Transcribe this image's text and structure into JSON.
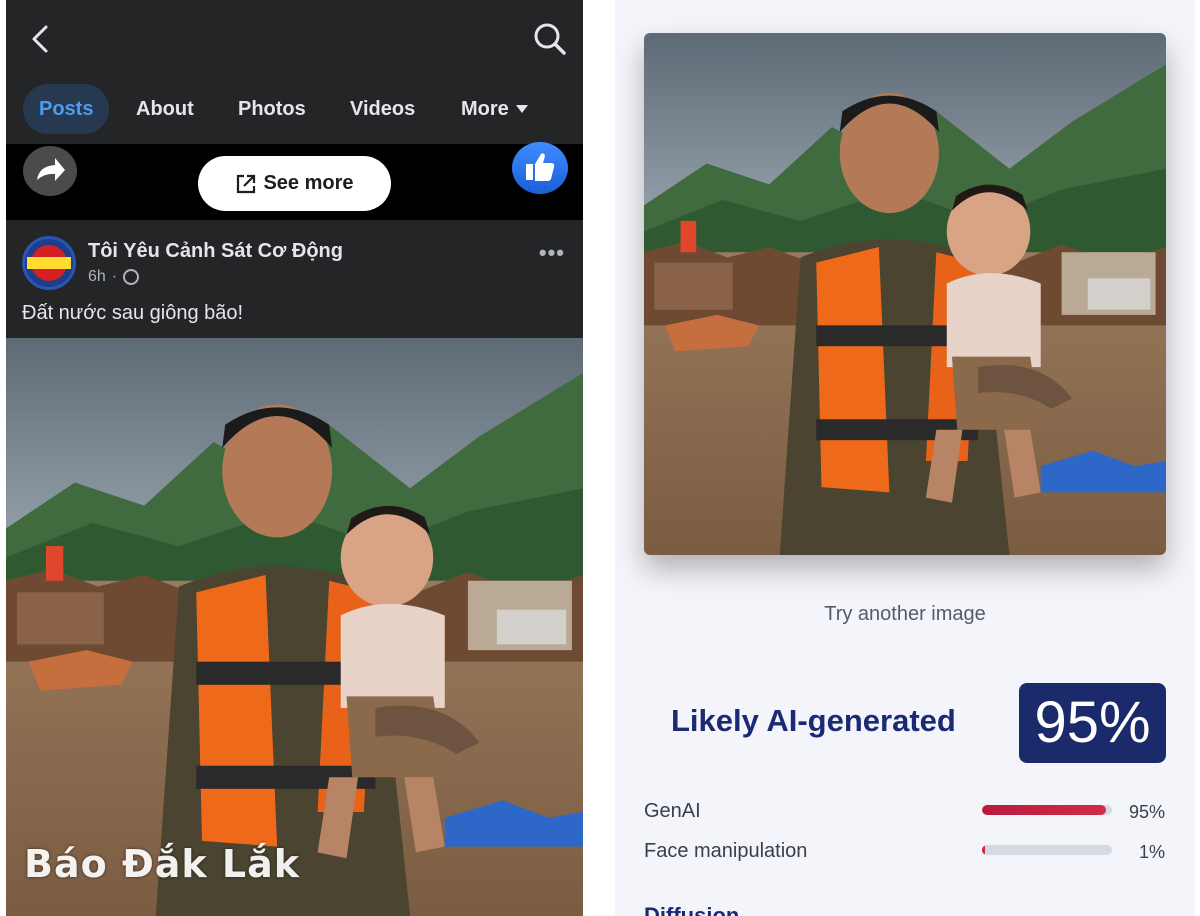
{
  "facebook": {
    "tabs": [
      "Posts",
      "About",
      "Photos",
      "Videos",
      "More"
    ],
    "see_more_label": "See more",
    "post": {
      "page_name": "Tôi Yêu Cảnh Sát Cơ Động",
      "time": "6h",
      "separator": "·",
      "text": "Đất nước sau giông bão!"
    },
    "watermark": "Báo Đắk Lắk"
  },
  "detector": {
    "try_another": "Try another image",
    "verdict": "Likely AI-generated",
    "score": "95%",
    "metrics": [
      {
        "label": "GenAI",
        "value": "95%",
        "fraction": 0.95
      },
      {
        "label": "Face manipulation",
        "value": "1%",
        "fraction": 0.01
      }
    ],
    "next_section": "Diffusion"
  },
  "colors": {
    "fb_background": "#242526",
    "fb_active_tab": "#4d9bf0",
    "verdict_text": "#1b2a73",
    "score_box": "#1a2a6b",
    "bar_fill": "#c8213f"
  }
}
